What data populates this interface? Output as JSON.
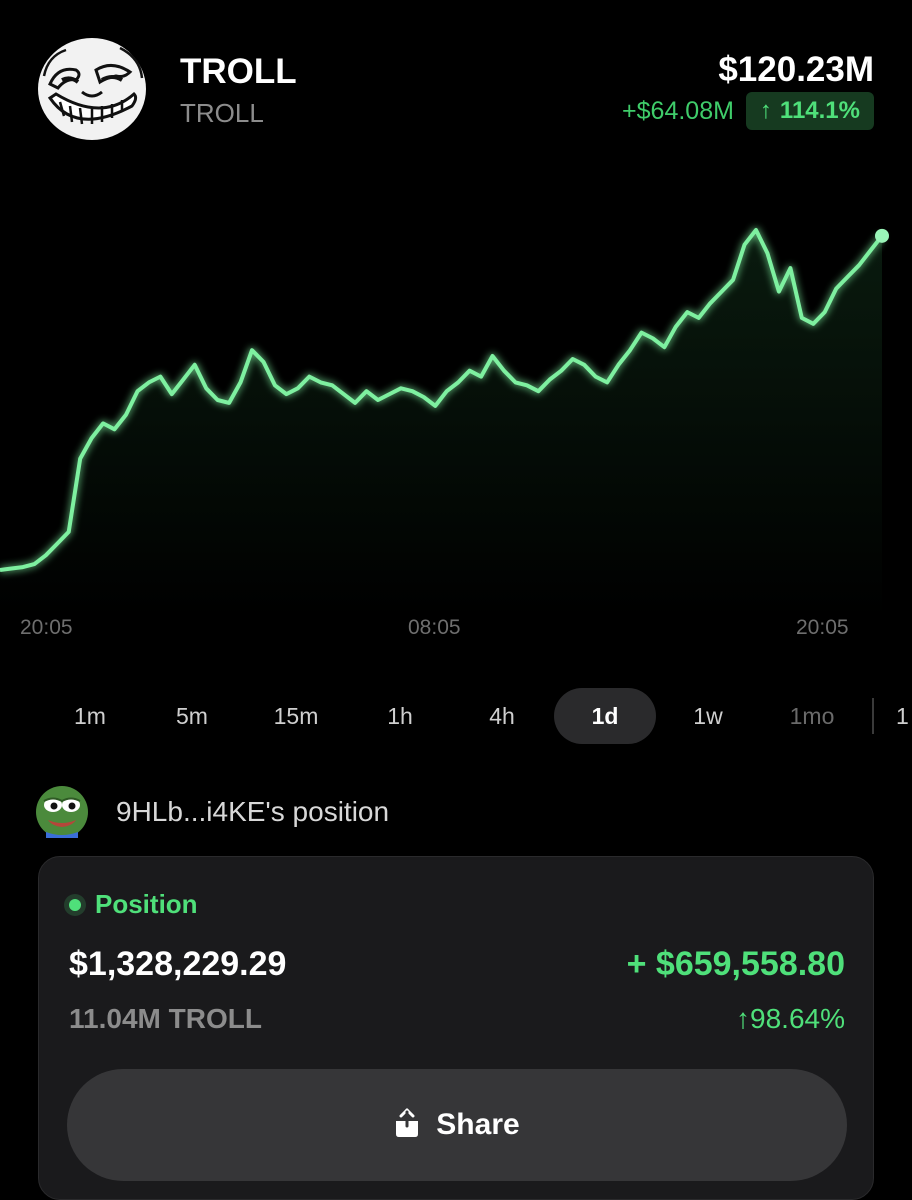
{
  "token": {
    "name": "TROLL",
    "symbol": "TROLL",
    "logo_icon": "trollface-icon",
    "market_cap": "$120.23M",
    "change_abs": "+$64.08M",
    "change_pct": "114.1%",
    "change_arrow": "↑"
  },
  "colors": {
    "accent_green": "#4fe07a",
    "background": "#000000",
    "card": "#1a1a1c"
  },
  "chart_data": {
    "type": "line",
    "title": "",
    "xlabel": "",
    "ylabel": "",
    "x_ticks": [
      "20:05",
      "08:05",
      "20:05"
    ],
    "grid": false,
    "series": [
      {
        "values": [
          20,
          20.5,
          21,
          22,
          25,
          29,
          33,
          58,
          65,
          70,
          68,
          73,
          81,
          84,
          86,
          80,
          85,
          90,
          82,
          78,
          77,
          84,
          95,
          91,
          83,
          80,
          82,
          86,
          84,
          83,
          80,
          77,
          81,
          78,
          80,
          82,
          81,
          79,
          76,
          81,
          84,
          88,
          86,
          93,
          88,
          84,
          83,
          81,
          85,
          88,
          92,
          90,
          86,
          84,
          90,
          95,
          101,
          99,
          96,
          103,
          108,
          106,
          111,
          115,
          119,
          131,
          136,
          128,
          115,
          123,
          106,
          104,
          108,
          116,
          120,
          124,
          129,
          134
        ]
      }
    ]
  },
  "intervals": [
    {
      "label": "1m"
    },
    {
      "label": "5m"
    },
    {
      "label": "15m"
    },
    {
      "label": "1h"
    },
    {
      "label": "4h"
    },
    {
      "label": "1d"
    },
    {
      "label": "1w"
    },
    {
      "label": "1mo"
    },
    {
      "label": "1"
    }
  ],
  "active_interval": "1d",
  "owner": {
    "avatar_icon": "pepe-avatar-icon",
    "address": "9HLb...i4KE",
    "suffix": "'s position"
  },
  "position": {
    "title": "Position",
    "value": "$1,328,229.29",
    "amount": "11.04M TROLL",
    "pnl_abs": "+ $659,558.80",
    "pnl_pct": "98.64%",
    "pnl_arrow": "↑"
  },
  "share": {
    "label": "Share",
    "icon": "share-icon"
  }
}
